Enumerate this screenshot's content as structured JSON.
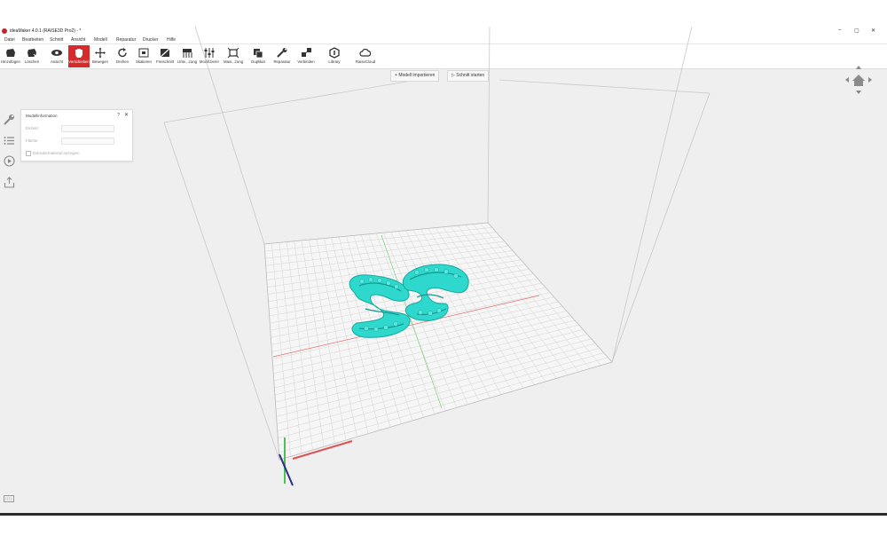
{
  "window": {
    "title": "ideaMaker 4.0.1 (RAISE3D Pro2) - *",
    "controls": [
      "–",
      "▢",
      "✕"
    ]
  },
  "menu": [
    "Datei",
    "Bearbeiten",
    "Schnitt",
    "Ansicht",
    "Modell",
    "Reparatur",
    "Drucker",
    "Hilfe"
  ],
  "toolbar": {
    "tools": [
      {
        "label": "Hinzufügen",
        "icon": "add-model-icon"
      },
      {
        "label": "Löschen",
        "icon": "delete-icon"
      },
      {
        "label": "Ansicht",
        "icon": "eye-icon"
      },
      {
        "label": "Verschieben",
        "icon": "hand-icon",
        "active": true
      },
      {
        "label": "Bewegen",
        "icon": "move-icon"
      },
      {
        "label": "Drehen",
        "icon": "rotate-icon"
      },
      {
        "label": "Skalieren",
        "icon": "scale-icon"
      },
      {
        "label": "Freischnitt",
        "icon": "cut-icon"
      },
      {
        "label": "Unte...zung",
        "icon": "support-icon"
      },
      {
        "label": "Modifizierer",
        "icon": "modifier-icon"
      },
      {
        "label": "Maxi...zung",
        "icon": "maximize-icon"
      },
      {
        "label": "Duplikat",
        "icon": "duplicate-icon"
      },
      {
        "label": "Reparatur",
        "icon": "repair-icon"
      },
      {
        "label": "Verbinden",
        "icon": "connect-icon"
      },
      {
        "label": "Library",
        "icon": "library-icon"
      },
      {
        "label": "RaiseCloud",
        "icon": "cloud-icon"
      }
    ]
  },
  "actions": {
    "import_label": "Modell importieren",
    "slice_label": "Schnitt starten"
  },
  "panel": {
    "title": "Modellinformation",
    "help": "?",
    "close": "✕",
    "row1_label": "Einheit",
    "row2_label": "Fläche",
    "checkbox_label": "Extrudermaterial anzeigen"
  },
  "colors": {
    "accent": "#d72b2b",
    "model": "#2ed8cc",
    "grid": "#c9c9c9",
    "axis_x": "#e05050",
    "axis_y": "#4fbf4f",
    "axis_z": "#3a3aa0"
  }
}
